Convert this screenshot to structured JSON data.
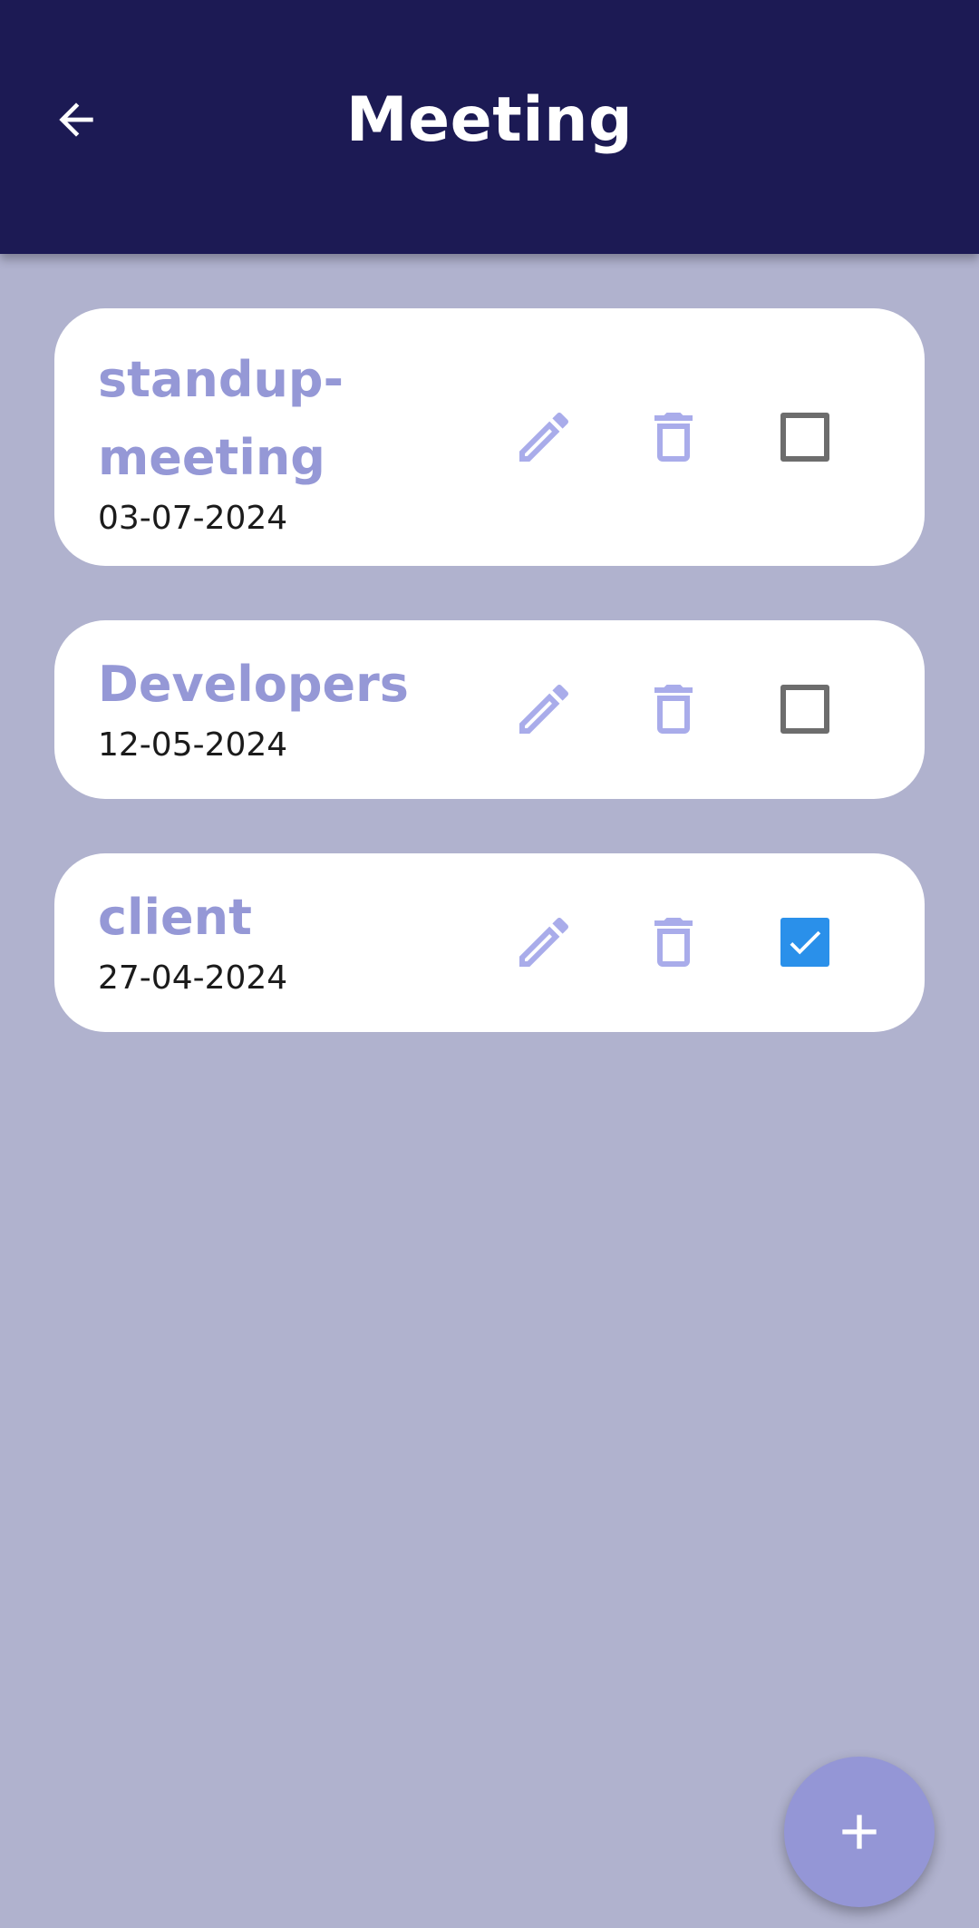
{
  "appbar": {
    "title": "Meeting",
    "back_icon": "arrow-left-icon"
  },
  "meetings": [
    {
      "title": "standup-meeting",
      "title_line1": "standup-",
      "title_line2": "meeting",
      "date": "03-07-2024",
      "checked": false
    },
    {
      "title": "Developers",
      "date": "12-05-2024",
      "checked": false
    },
    {
      "title": "client",
      "date": "27-04-2024",
      "checked": true
    }
  ],
  "icons": {
    "edit": "pencil-icon",
    "delete": "trash-icon",
    "checkbox": "checkbox-icon",
    "add": "plus-icon"
  },
  "colors": {
    "appbar_bg": "#1c1a54",
    "page_bg": "#b0b2ce",
    "title_text": "#9598d6",
    "icon": "#a9acea",
    "checkbox_checked": "#2a90ea",
    "checkbox_unchecked_border": "#6d6d6d",
    "fab_bg": "#9496d6"
  }
}
